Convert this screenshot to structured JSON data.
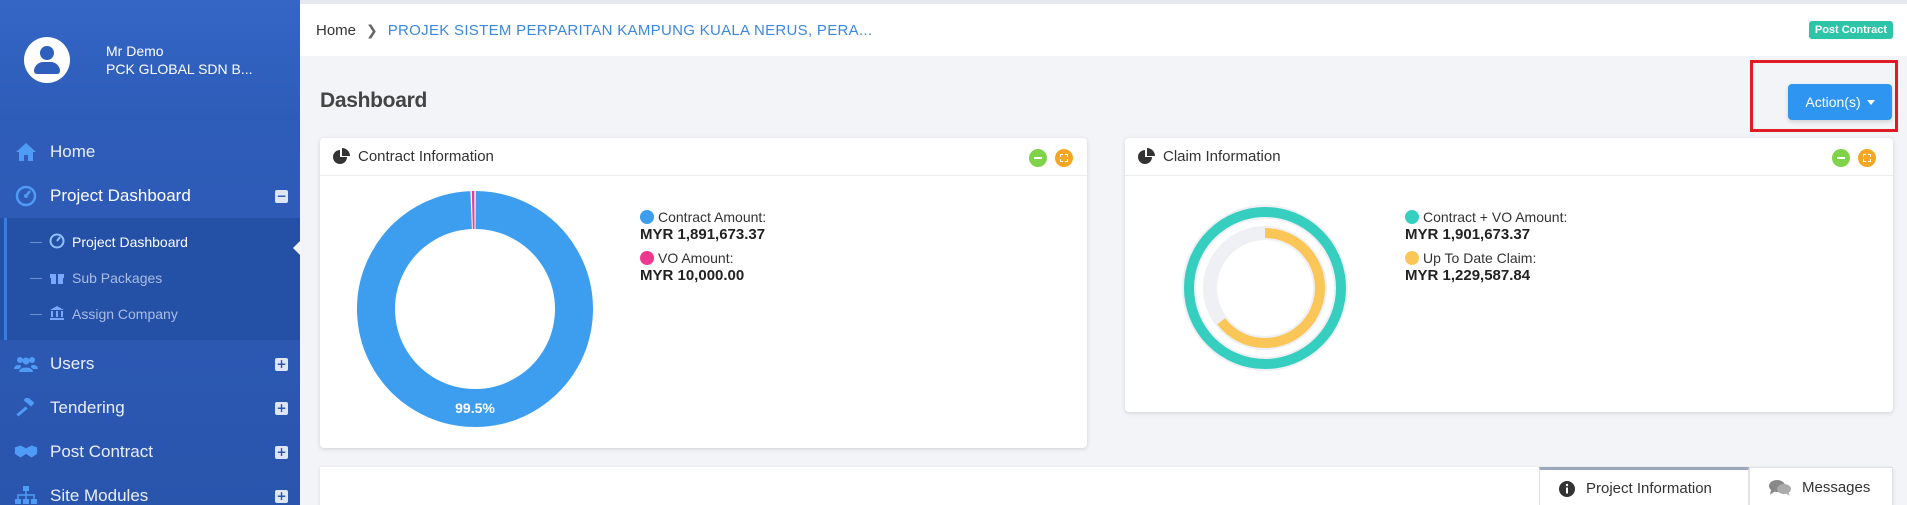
{
  "user": {
    "name": "Mr Demo",
    "company": "PCK GLOBAL SDN B..."
  },
  "sidebar": {
    "items": [
      {
        "label": "Home",
        "icon": "home-icon"
      },
      {
        "label": "Project Dashboard",
        "icon": "dashboard-icon",
        "toggle": "−"
      },
      {
        "label": "Users",
        "icon": "users-icon",
        "toggle": "+"
      },
      {
        "label": "Tendering",
        "icon": "gavel-icon",
        "toggle": "+"
      },
      {
        "label": "Post Contract",
        "icon": "handshake-icon",
        "toggle": "+"
      },
      {
        "label": "Site Modules",
        "icon": "sitemap-icon",
        "toggle": "+"
      }
    ],
    "subitems": [
      {
        "label": "Project Dashboard",
        "icon": "dashboard-icon"
      },
      {
        "label": "Sub Packages",
        "icon": "gift-icon"
      },
      {
        "label": "Assign Company",
        "icon": "bank-icon"
      }
    ]
  },
  "breadcrumb": {
    "home": "Home",
    "project": "PROJEK SISTEM PERPARITAN KAMPUNG KUALA NERUS, PERA..."
  },
  "status_badge": "Post Contract",
  "page_title": "Dashboard",
  "actions_label": "Action(s)",
  "contract_card": {
    "title": "Contract Information",
    "legend": [
      {
        "label": "Contract Amount:",
        "value": "MYR 1,891,673.37",
        "color": "#3d9ef0"
      },
      {
        "label": "VO Amount:",
        "value": "MYR 10,000.00",
        "color": "#f0378f"
      }
    ]
  },
  "claim_card": {
    "title": "Claim Information",
    "legend": [
      {
        "label": "Contract + VO Amount:",
        "value": "MYR 1,901,673.37",
        "color": "#36cfbf"
      },
      {
        "label": "Up To Date Claim:",
        "value": "MYR 1,229,587.84",
        "color": "#fbc658"
      }
    ]
  },
  "chart_data": [
    {
      "type": "pie",
      "categories": [
        "Contract Amount",
        "VO Amount"
      ],
      "values": [
        1891673.37,
        10000.0
      ],
      "data_label": "99.5%"
    },
    {
      "type": "pie",
      "categories": [
        "Contract + VO Amount",
        "Up To Date Claim"
      ],
      "values": [
        1901673.37,
        1229587.84
      ]
    }
  ],
  "tabs": [
    {
      "label": "Project Information",
      "icon": "info-icon"
    },
    {
      "label": "Messages",
      "icon": "comments-icon"
    }
  ]
}
